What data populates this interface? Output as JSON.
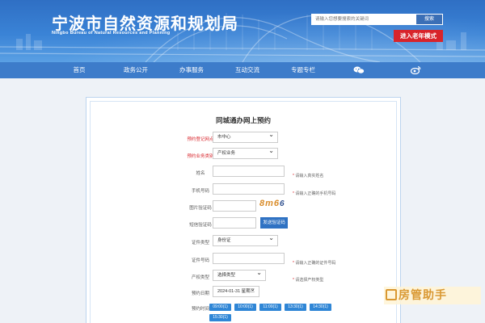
{
  "header": {
    "title_cn": "宁波市自然资源和规划局",
    "title_en": "Ningbo Bureau of Natural Resources and Planning",
    "search_placeholder": "请输入您想要搜索的关键词",
    "search_label": "搜索",
    "elder_mode_label": "进入老年模式"
  },
  "nav": {
    "items": [
      {
        "label": "首页"
      },
      {
        "label": "政务公开"
      },
      {
        "label": "办事服务"
      },
      {
        "label": "互动交流"
      },
      {
        "label": "专题专栏"
      }
    ],
    "wechat_icon": "wechat-icon",
    "weibo_icon": "weibo-icon"
  },
  "form": {
    "title": "同城通办网上预约",
    "office": {
      "label": "预约登记网点",
      "value": "市中心"
    },
    "business": {
      "label": "预约业务类别",
      "value": "产权业务"
    },
    "name": {
      "label": "姓名",
      "hint": "请输入真实姓名"
    },
    "phone": {
      "label": "手机号码",
      "hint": "请输入正确的手机号码"
    },
    "captcha": {
      "label": "图片验证码",
      "image_text": "8m6"
    },
    "sms": {
      "label": "短信验证码",
      "button": "发送验证码"
    },
    "id_type": {
      "label": "证件类型",
      "value": "身份证"
    },
    "id_number": {
      "label": "证件号码",
      "hint": "请输入正确的证件号码"
    },
    "property_type": {
      "label": "产权类型",
      "value": "选择类型",
      "hint": "请选择产权类型"
    },
    "date": {
      "label": "预约日期",
      "value": "2024-01-31 星期三"
    },
    "time": {
      "label": "预约时间",
      "slots": [
        "09:00(1)",
        "10:00(1)",
        "11:00(1)",
        "13:30(1)",
        "14:30(1)",
        "15:30(1)"
      ]
    }
  },
  "watermark": {
    "text": "房管助手"
  },
  "colors": {
    "brand_blue": "#3d7cca",
    "accent_red": "#d8242b",
    "chip_blue": "#2f86d6"
  }
}
